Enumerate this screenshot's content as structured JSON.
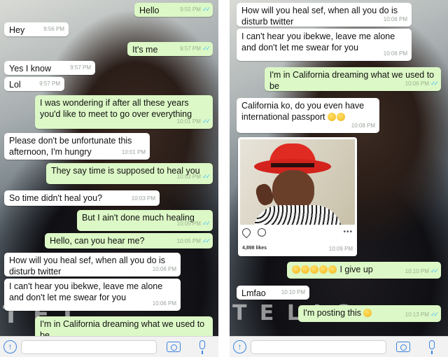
{
  "left": {
    "messages": [
      {
        "dir": "out",
        "text": "Hello",
        "time": "9:55 PM"
      },
      {
        "dir": "in",
        "text": "Hey",
        "time": "9:56 PM"
      },
      {
        "dir": "out",
        "text": "It's me",
        "time": "9:57 PM"
      },
      {
        "dir": "in",
        "text": "Yes I know",
        "time": "9:57 PM"
      },
      {
        "dir": "in",
        "text": "Lol",
        "time": "9:57 PM"
      },
      {
        "dir": "out",
        "text": "I was wondering if after all these years you'd like to meet to go over everything",
        "time": "10:01 PM"
      },
      {
        "dir": "in",
        "text": "Please don't be unfortunate this afternoon, I'm hungry",
        "time": "10:01 PM"
      },
      {
        "dir": "out",
        "text": "They say time is supposed to heal you",
        "time": "10:03 PM"
      },
      {
        "dir": "in",
        "text": "So time didn't heal you?",
        "time": "10:03 PM"
      },
      {
        "dir": "out",
        "text": "But I ain't done much healing",
        "time": "10:05 PM"
      },
      {
        "dir": "out",
        "text": "Hello, can you hear me?",
        "time": "10:05 PM"
      },
      {
        "dir": "in",
        "text": "How will you heal sef, when all you do is disturb twitter",
        "time": "10:06 PM"
      },
      {
        "dir": "in",
        "text": "I can't hear you ibekwe, leave me alone and don't let me swear for you",
        "time": "10:06 PM"
      },
      {
        "dir": "out",
        "text": "I'm in California dreaming what we used to be",
        "time": ""
      }
    ]
  },
  "right": {
    "messages": [
      {
        "dir": "in",
        "text": "How will you heal sef, when all you do is disturb twitter",
        "time": "10:06 PM"
      },
      {
        "dir": "in",
        "text": "I can't hear you ibekwe, leave me alone and don't let me swear for you",
        "time": "10:06 PM"
      },
      {
        "dir": "out",
        "text": "I'm in California dreaming what we used to be",
        "time": "10:06 PM"
      },
      {
        "dir": "in",
        "text": "California ko, do you even have international passport",
        "time": "10:08 PM"
      },
      {
        "dir": "out",
        "text": "I give up",
        "time": "10:10 PM"
      },
      {
        "dir": "in",
        "text": "Lmfao",
        "time": "10:10 PM"
      },
      {
        "dir": "out",
        "text": "I'm posting this",
        "time": "10:13 PM"
      }
    ],
    "insta_post": {
      "likes": "4,898 likes",
      "time": "10:09 PM"
    }
  },
  "icons": {
    "upload": "upload-icon",
    "camera": "camera-icon",
    "mic": "microphone-icon",
    "read_receipt": "double-check-icon",
    "emoji": "laughing-face-emoji"
  },
  "colors": {
    "incoming_bubble": "#ffffff",
    "outgoing_bubble": "#dcf8c6",
    "accent": "#3a83e0",
    "read_ticks": "#4fc3f7"
  }
}
